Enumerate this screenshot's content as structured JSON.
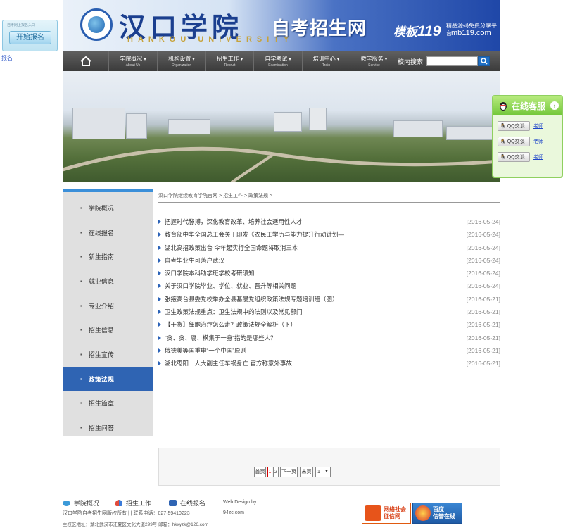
{
  "apply_widget": {
    "caption": "自考网上报名入口",
    "button_label": "开始报名",
    "side_link": "报名"
  },
  "header": {
    "brand_cn": "汉口学院",
    "brand_en": "HANKOU UNIVERSITY",
    "site_title": "自考招生网",
    "mb_badge_prefix": "模板",
    "mb_badge_number": "119",
    "mb_desc": "精品源码免费分享平台",
    "mb_url": "mb119.com"
  },
  "nav": {
    "items": [
      {
        "cn": "学院概况",
        "en": "About Us"
      },
      {
        "cn": "机构设置",
        "en": "Organization"
      },
      {
        "cn": "招生工作",
        "en": "Recruit"
      },
      {
        "cn": "自学考试",
        "en": "Examination"
      },
      {
        "cn": "培训中心",
        "en": "Train"
      },
      {
        "cn": "教学服务",
        "en": "Service"
      }
    ],
    "search_label": "校内搜索"
  },
  "kefu": {
    "title": "在线客服",
    "rows": [
      {
        "button": "QQ交谈",
        "name": "老师"
      },
      {
        "button": "QQ交谈",
        "name": "老师"
      },
      {
        "button": "QQ交谈",
        "name": "老师"
      }
    ]
  },
  "left_menu": {
    "items": [
      "学院概况",
      "在线报名",
      "新生指南",
      "就业信息",
      "专业介绍",
      "招生信息",
      "招生宣传",
      "政策法规",
      "招生篇章",
      "招生问答"
    ],
    "active_index": 7
  },
  "breadcrumb": "汉口学院继续教育学院官网 > 招生工作 > 政策法规 >",
  "news": [
    {
      "title": "把握时代脉搏，深化教育改革、培养社会适用性人才",
      "date": "[2016-05-24]"
    },
    {
      "title": "教育部中华全国总工会关于印发《农民工学历与能力提升行动计划—",
      "date": "[2016-05-24]"
    },
    {
      "title": "湖北高招政策出台 今年起实行全国命题将取消三本",
      "date": "[2016-05-24]"
    },
    {
      "title": "自考毕业生可落户武汉",
      "date": "[2016-05-24]"
    },
    {
      "title": "汉口学院本科助学班学校考研须知",
      "date": "[2016-05-24]"
    },
    {
      "title": "关于汉口学院毕业、学位、就业、晋升等相关问题",
      "date": "[2016-05-24]"
    },
    {
      "title": "张掖高台县委党校举办全县基层党组织政策法规专题培训班（图）",
      "date": "[2016-05-21]"
    },
    {
      "title": "卫生政策法规重点：卫生法规中的法则以及常见部门",
      "date": "[2016-05-21]"
    },
    {
      "title": "【干货】细胞治疗怎么走？政策法规全解析（下）",
      "date": "[2016-05-21]"
    },
    {
      "title": "“贪、贪、腐、横集于一身”指的是哪些人？",
      "date": "[2016-05-21]"
    },
    {
      "title": "俄德美等国重申“一个中国”原则",
      "date": "[2016-05-21]"
    },
    {
      "title": "湖北枣阳一人大副主任车祸身亡 官方称意外事故",
      "date": "[2016-05-21]"
    }
  ],
  "pager": {
    "first": "首页",
    "pages": [
      "1",
      "2"
    ],
    "next": "下一页",
    "last": "末页",
    "select_value": "1"
  },
  "footer": {
    "links": [
      "学院概况",
      "招生工作",
      "在线报名"
    ],
    "design_by": "Web Design by",
    "design_site": "94zc.com",
    "copyright": "汉口学院自考招生网版权所有 | | 联系电话：027-59410223",
    "address": "主校区地址：湖北武汉市江夏区文化大道299号 邮箱：hkxyzk@126.com",
    "badge1": [
      "网络社会",
      "征信网"
    ],
    "badge2": [
      "百度",
      "信誉在线"
    ]
  }
}
